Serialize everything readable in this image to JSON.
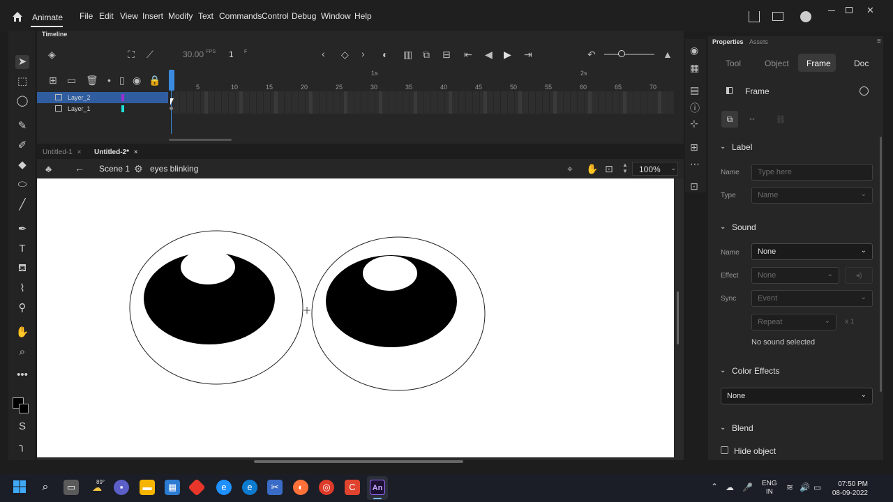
{
  "app": {
    "name": "Animate"
  },
  "menu": [
    "File",
    "Edit",
    "View",
    "Insert",
    "Modify",
    "Text",
    "Commands",
    "Control",
    "Debug",
    "Window",
    "Help"
  ],
  "timeline": {
    "tab_label": "Timeline",
    "fps": "30.00",
    "fps_unit": "FPS",
    "current_frame": "1",
    "frame_unit": "F",
    "frame_numbers": [
      "5",
      "10",
      "15",
      "20",
      "25",
      "30",
      "35",
      "40",
      "45",
      "50",
      "55",
      "60",
      "65",
      "70"
    ],
    "second_markers": [
      "1s",
      "2s"
    ],
    "layers": [
      {
        "name": "Layer_2",
        "color": "#9b2fd1",
        "selected": true
      },
      {
        "name": "Layer_1",
        "color": "#1ee0d8",
        "selected": false
      }
    ]
  },
  "documents": {
    "tabs": [
      {
        "label": "Untitled-1",
        "active": false
      },
      {
        "label": "Untitled-2*",
        "active": true
      }
    ]
  },
  "editbar": {
    "scene": "Scene 1",
    "symbol": "eyes blinking",
    "zoom": "100%"
  },
  "properties": {
    "panel_tabs": [
      "Properties",
      "Assets"
    ],
    "mode_tabs": [
      "Tool",
      "Object",
      "Frame",
      "Doc"
    ],
    "active_mode": "Frame",
    "header": "Frame",
    "label_section": {
      "title": "Label",
      "name_label": "Name",
      "name_placeholder": "Type here",
      "type_label": "Type",
      "type_value": "Name"
    },
    "sound_section": {
      "title": "Sound",
      "name_label": "Name",
      "name_value": "None",
      "effect_label": "Effect",
      "effect_value": "None",
      "sync_label": "Sync",
      "sync_value": "Event",
      "repeat_value": "Repeat",
      "repeat_count": "x 1",
      "status": "No sound selected"
    },
    "color_effects": {
      "title": "Color Effects",
      "value": "None"
    },
    "blend": {
      "title": "Blend",
      "hide_object": "Hide object"
    }
  },
  "taskbar": {
    "weather": "89°",
    "language": "ENG",
    "region": "IN",
    "time": "07:50 PM",
    "date": "08-09-2022"
  }
}
